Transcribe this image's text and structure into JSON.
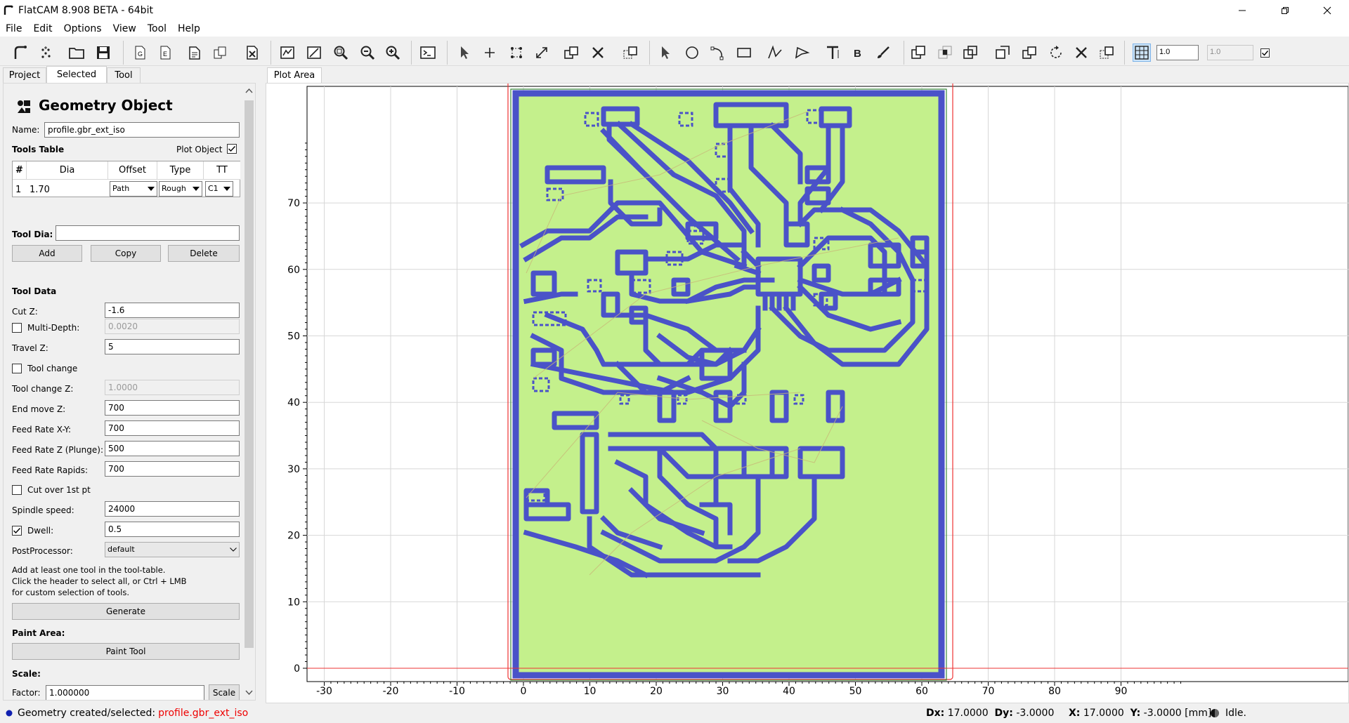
{
  "window": {
    "title": "FlatCAM 8.908 BETA - 64bit"
  },
  "menu": [
    "File",
    "Edit",
    "Options",
    "View",
    "Tool",
    "Help"
  ],
  "toolbar": {
    "grid_x": "1.0",
    "grid_y": "1.0"
  },
  "tabs": {
    "project": "Project",
    "selected": "Selected",
    "tool": "Tool",
    "plot_area": "Plot Area"
  },
  "panel": {
    "title": "Geometry Object",
    "name_label": "Name:",
    "name_value": "profile.gbr_ext_iso",
    "tools_table_label": "Tools Table",
    "plot_object_label": "Plot Object",
    "table_headers": [
      "#",
      "Dia",
      "Offset",
      "Type",
      "TT"
    ],
    "table_row": {
      "num": "1",
      "dia": "1.70",
      "offset": "Path",
      "type": "Rough",
      "tt": "C1"
    },
    "tool_dia_label": "Tool Dia:",
    "tool_dia_value": "",
    "add_label": "Add",
    "copy_label": "Copy",
    "delete_label": "Delete",
    "tool_data_label": "Tool Data",
    "cut_z_label": "Cut Z:",
    "cut_z_value": "-1.6",
    "multi_depth_label": "Multi-Depth:",
    "multi_depth_value": "0.0020",
    "travel_z_label": "Travel Z:",
    "travel_z_value": "5",
    "tool_change_label": "Tool change",
    "tool_change_z_label": "Tool change Z:",
    "tool_change_z_value": "1.0000",
    "end_move_z_label": "End move Z:",
    "end_move_z_value": "700",
    "feed_xy_label": "Feed Rate X-Y:",
    "feed_xy_value": "700",
    "feed_z_label": "Feed Rate Z (Plunge):",
    "feed_z_value": "500",
    "feed_rapids_label": "Feed Rate Rapids:",
    "feed_rapids_value": "700",
    "cut_over_label": "Cut over 1st pt",
    "spindle_label": "Spindle speed:",
    "spindle_value": "24000",
    "dwell_label": "Dwell:",
    "dwell_value": "0.5",
    "postprocessor_label": "PostProcessor:",
    "postprocessor_value": "default",
    "hint_line1": "Add at least one tool in the tool-table.",
    "hint_line2": "Click the header to select all, or Ctrl + LMB",
    "hint_line3": "for custom selection of tools.",
    "generate_label": "Generate",
    "paint_area_label": "Paint Area:",
    "paint_tool_label": "Paint Tool",
    "scale_label": "Scale:",
    "factor_label": "Factor:",
    "factor_value": "1.000000",
    "scale_button": "Scale"
  },
  "plot": {
    "x_ticks": [
      "-30",
      "-20",
      "-10",
      "0",
      "10",
      "20",
      "30",
      "40",
      "50",
      "60",
      "70",
      "80",
      "90"
    ],
    "y_ticks": [
      "0",
      "10",
      "20",
      "30",
      "40",
      "50",
      "60",
      "70"
    ],
    "board_fill": "#c4f08c",
    "trace_color": "#4a52c8"
  },
  "status": {
    "message_prefix": "Geometry created/selected:",
    "message_object": "profile.gbr_ext_iso",
    "dx_label": "Dx:",
    "dx_value": "17.0000",
    "dy_label": "Dy:",
    "dy_value": "-3.0000",
    "x_label": "X:",
    "x_value": "17.0000",
    "y_label": "Y:",
    "y_value": "-3.0000",
    "units": "[mm]",
    "state": "Idle."
  }
}
